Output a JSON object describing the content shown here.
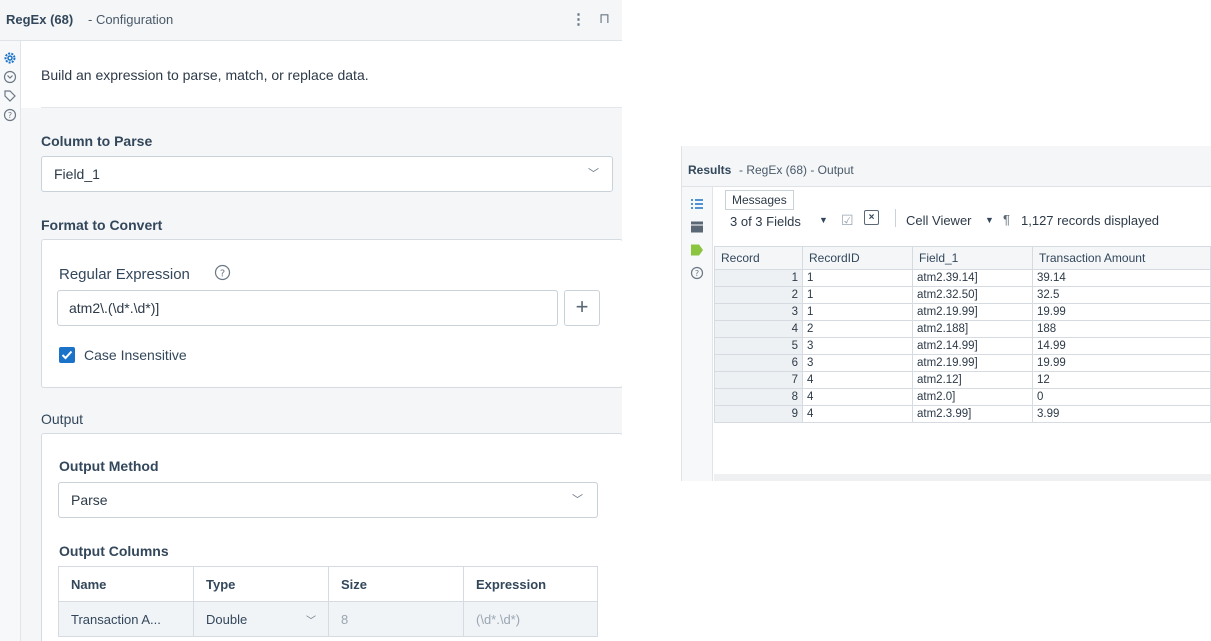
{
  "config": {
    "title": "RegEx (68)",
    "subtitle": "- Configuration",
    "intro": "Build an expression to parse, match, or replace data.",
    "column_to_parse": {
      "label": "Column to Parse",
      "value": "Field_1"
    },
    "format_to_convert": {
      "label": "Format to Convert"
    },
    "regex": {
      "label": "Regular Expression",
      "value": "atm2\\.(\\d*.\\d*)]",
      "add_label": "+",
      "case_insensitive_label": "Case Insensitive",
      "case_insensitive": true
    },
    "output": {
      "label": "Output",
      "method_label": "Output Method",
      "method_value": "Parse",
      "columns_label": "Output Columns",
      "columns_headers": [
        "Name",
        "Type",
        "Size",
        "Expression"
      ],
      "columns_row": {
        "name": "Transaction A...",
        "type": "Double",
        "size": "8",
        "expression": "(\\d*.\\d*)"
      }
    }
  },
  "results": {
    "title": "Results",
    "subtitle": "- RegEx (68) - Output",
    "tooltip": "Messages",
    "fields_label": "3 of 3 Fields",
    "cell_viewer_label": "Cell Viewer",
    "records_label": "1,127 records displayed",
    "headers": [
      "Record",
      "RecordID",
      "Field_1",
      "Transaction Amount"
    ],
    "rows": [
      [
        "1",
        "1",
        "atm2.39.14]",
        "39.14"
      ],
      [
        "2",
        "1",
        "atm2.32.50]",
        "32.5"
      ],
      [
        "3",
        "1",
        "atm2.19.99]",
        "19.99"
      ],
      [
        "4",
        "2",
        "atm2.188]",
        "188"
      ],
      [
        "5",
        "3",
        "atm2.14.99]",
        "14.99"
      ],
      [
        "6",
        "3",
        "atm2.19.99]",
        "19.99"
      ],
      [
        "7",
        "4",
        "atm2.12]",
        "12"
      ],
      [
        "8",
        "4",
        "atm2.0]",
        "0"
      ],
      [
        "9",
        "4",
        "atm2.3.99]",
        "3.99"
      ]
    ]
  },
  "colors": {
    "accent": "#1a73c8",
    "active_icon": "#8bc53f"
  }
}
